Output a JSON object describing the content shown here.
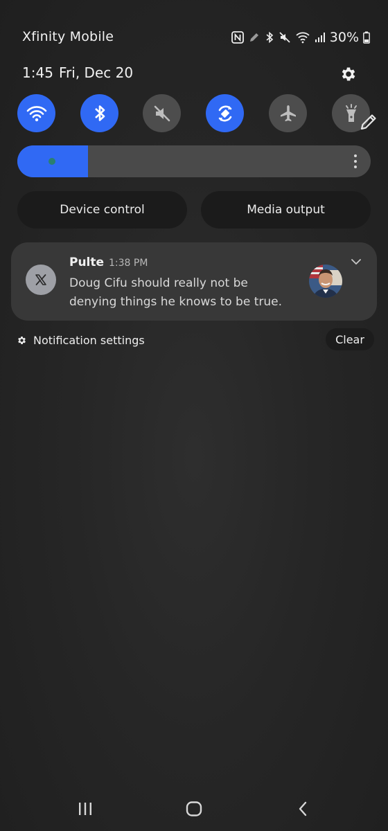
{
  "status_bar": {
    "carrier": "Xfinity Mobile",
    "battery_percent": "30%",
    "icons": [
      "nfc-icon",
      "pen-icon",
      "bluetooth-icon",
      "mute-icon",
      "wifi-icon",
      "cell-signal-icon",
      "battery-icon"
    ]
  },
  "header": {
    "time": "1:45",
    "date": "Fri, Dec 20",
    "settings_icon": "gear-icon"
  },
  "quick_toggles": [
    {
      "name": "wifi",
      "icon": "wifi-icon",
      "on": true
    },
    {
      "name": "bluetooth",
      "icon": "bluetooth-icon",
      "on": true
    },
    {
      "name": "sound",
      "icon": "mute-icon",
      "on": false
    },
    {
      "name": "auto-rotate",
      "icon": "rotate-icon",
      "on": true
    },
    {
      "name": "airplane-mode",
      "icon": "airplane-icon",
      "on": false
    },
    {
      "name": "flashlight",
      "icon": "flashlight-icon",
      "on": false
    }
  ],
  "brightness": {
    "level": 0.2,
    "menu_icon": "more-vertical-icon"
  },
  "buttons": {
    "device_control": "Device control",
    "media_output": "Media output"
  },
  "notification": {
    "app_icon": "x-logo-icon",
    "title": "Pulte",
    "time": "1:38 PM",
    "body": "Doug Cifu should really not be denying things he knows to be true.",
    "expand_icon": "chevron-down-icon"
  },
  "footer": {
    "notification_settings": "Notification settings",
    "clear": "Clear"
  },
  "nav_bar": {
    "icons": [
      "recents-icon",
      "home-icon",
      "back-icon"
    ]
  },
  "colors": {
    "accent": "#3069f4",
    "toggle_off": "#4d4d4d",
    "card": "#383838",
    "background": "#262626"
  }
}
